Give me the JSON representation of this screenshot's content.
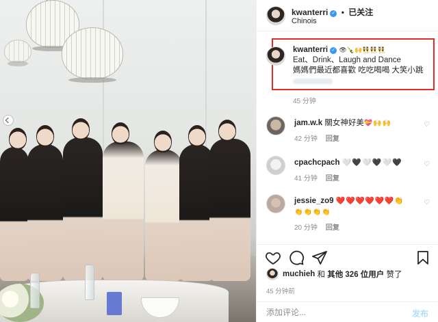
{
  "post": {
    "username": "kwanterri",
    "follow_sep": "•",
    "follow_label": "已关注",
    "location": "Chinois"
  },
  "caption": {
    "username": "kwanterri",
    "emojis": "👁🍾🙌👯👯👯",
    "line1": "Eat、Drink、Laugh and Dance",
    "line2": "媽媽們最近都喜歡 吃吃喝喝 大笑小跳",
    "time": "45 分钟"
  },
  "comments": [
    {
      "username": "jam.w.k",
      "text": "關女神好美",
      "emojis": "💝🙌🙌",
      "time": "42 分钟",
      "reply": "回复"
    },
    {
      "username": "cpachcpach",
      "text": "",
      "emojis": "🤍🖤🤍🖤🤍🖤",
      "time": "41 分钟",
      "reply": "回复"
    },
    {
      "username": "jessie_zo9",
      "text": "",
      "emojis": "❤️❤️❤️❤️❤️❤️👏",
      "emojis2": "👏👏👏👏",
      "time": "20 分钟",
      "reply": "回复"
    }
  ],
  "likes": {
    "user": "muchieh",
    "and": "和",
    "others": "其他 326 位用户",
    "suffix": "赞了"
  },
  "post_time": "45 分钟前",
  "add_comment": {
    "placeholder": "添加评论...",
    "post_label": "发布"
  },
  "icons": {
    "like": "heart-icon",
    "comment": "comment-icon",
    "share": "share-icon",
    "save": "bookmark-icon",
    "verified": "verified-badge-icon"
  },
  "colors": {
    "highlight_box": "#e02b26",
    "verified": "#3897f0",
    "secondary_text": "#8e8e8e",
    "post_button_disabled": "#b2dffc"
  }
}
